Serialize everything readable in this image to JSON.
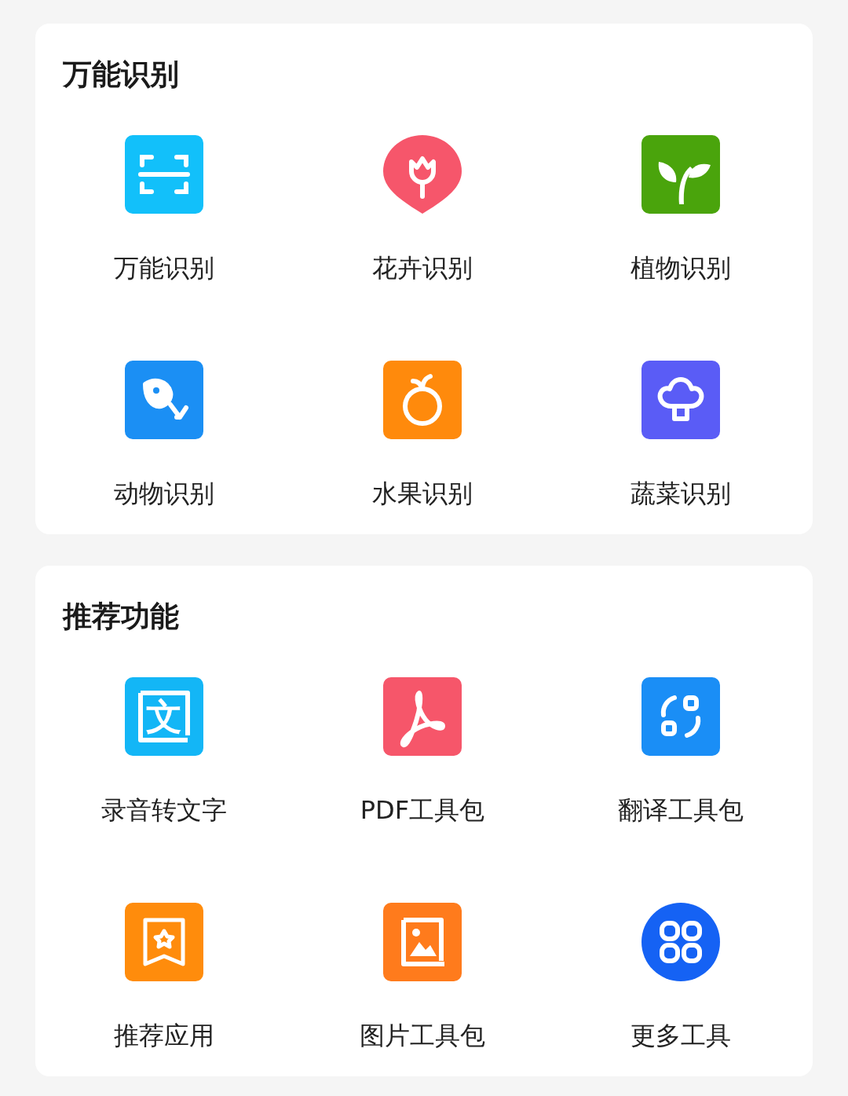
{
  "sections": [
    {
      "title": "万能识别",
      "items": [
        {
          "label": "万能识别",
          "kind": "square",
          "color": "#12c0fa"
        },
        {
          "label": "花卉识别",
          "kind": "pin",
          "color": "#f6566b"
        },
        {
          "label": "植物识别",
          "kind": "square",
          "color": "#4aa40c"
        },
        {
          "label": "动物识别",
          "kind": "square",
          "color": "#1b8ff4"
        },
        {
          "label": "水果识别",
          "kind": "square",
          "color": "#ff8a0c"
        },
        {
          "label": "蔬菜识别",
          "kind": "square",
          "color": "#5a5cf6"
        }
      ]
    },
    {
      "title": "推荐功能",
      "items": [
        {
          "label": "录音转文字",
          "kind": "square",
          "color": "#13b6f6",
          "glyph": "文"
        },
        {
          "label": "PDF工具包",
          "kind": "square",
          "color": "#f6566a"
        },
        {
          "label": "翻译工具包",
          "kind": "square",
          "color": "#1a8ef6"
        },
        {
          "label": "推荐应用",
          "kind": "square",
          "color": "#ff8c0c"
        },
        {
          "label": "图片工具包",
          "kind": "square",
          "color": "#ff7b1c"
        },
        {
          "label": "更多工具",
          "kind": "circle",
          "color": "#1562f4"
        }
      ]
    }
  ]
}
